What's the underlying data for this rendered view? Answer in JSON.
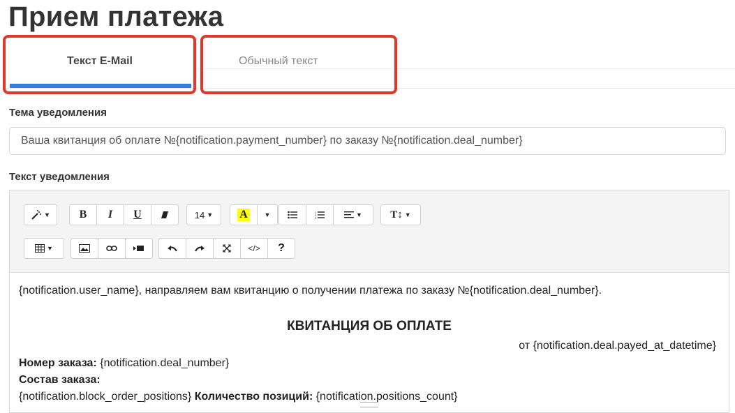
{
  "page": {
    "title": "Прием платежа"
  },
  "tabs": [
    {
      "label": "Текст E-Mail",
      "active": true
    },
    {
      "label": "Обычный текст",
      "active": false
    }
  ],
  "colors": {
    "accent": "#2f7de1",
    "highlight": "#e0362c",
    "highlight_color_button": "#ffff00"
  },
  "subject": {
    "label": "Тема уведомления",
    "value": "Ваша квитанция об оплате №{notification.payment_number} по заказу №{notification.deal_number}"
  },
  "body": {
    "label": "Текст уведомления",
    "toolbar": {
      "font_size": "14",
      "color_button": "A",
      "line_height_button": "T↕",
      "help": "?",
      "code_view": "</>",
      "icons": [
        "magic-icon",
        "bold-icon",
        "italic-icon",
        "underline-icon",
        "eraser-icon",
        "font-size-dropdown",
        "font-color-icon",
        "color-dropdown",
        "unordered-list-icon",
        "ordered-list-icon",
        "align-icon",
        "line-height-icon",
        "table-icon",
        "image-icon",
        "link-icon",
        "video-icon",
        "undo-icon",
        "redo-icon",
        "fullscreen-icon",
        "code-view-icon",
        "help-icon"
      ]
    },
    "content": {
      "line1": "{notification.user_name}, направляем вам квитанцию о получении платежа по заказу №{notification.deal_number}.",
      "receipt_title": "КВИТАНЦИЯ ОБ ОПЛАТЕ",
      "from_line": "от {notification.deal.payed_at_datetime}",
      "order_label": "Номер заказа:",
      "order_value": " {notification.deal_number}",
      "composition_label": "Состав заказа:",
      "positions_block": "{notification.block_order_positions} ",
      "positions_count_label": "Количество позиций:",
      "positions_count_value": " {notification.positions_count}"
    }
  }
}
